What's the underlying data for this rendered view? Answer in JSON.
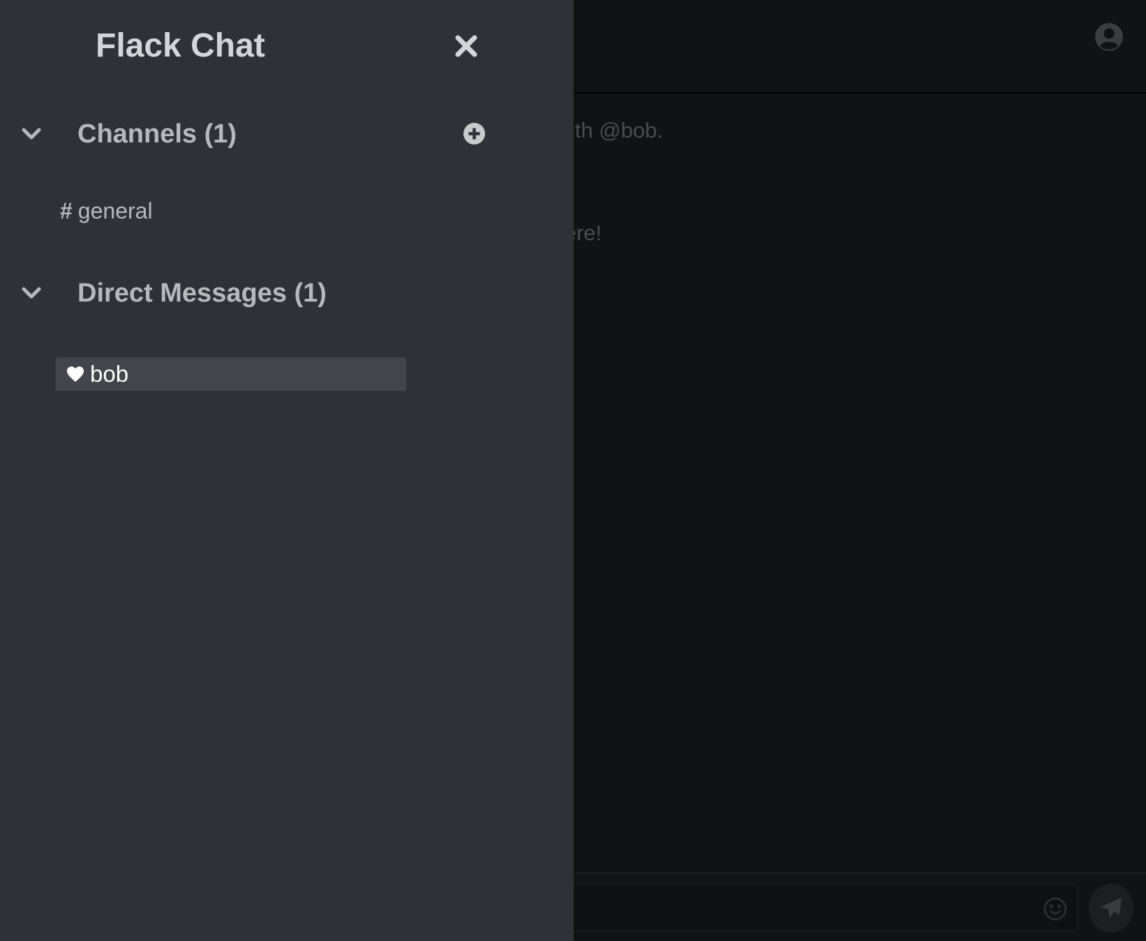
{
  "app": {
    "title": "Flack Chat"
  },
  "conversation": {
    "messages": [
      {
        "text": "th @bob."
      },
      {
        "text": "ere!"
      }
    ]
  },
  "sidebar": {
    "channels": {
      "title": "Channels (1)",
      "items": [
        {
          "label": "general",
          "prefix": "#"
        }
      ]
    },
    "direct_messages": {
      "title": "Direct Messages (1)",
      "items": [
        {
          "label": "bob",
          "icon": "heart-icon",
          "selected": true
        }
      ]
    }
  },
  "icons": {
    "close": "close-icon",
    "chevron": "chevron-down-icon",
    "add": "plus-circle-icon",
    "user": "user-circle-icon",
    "emoji": "emoji-icon",
    "send": "paper-plane-icon"
  },
  "colors": {
    "drawer_bg": "#303136",
    "main_bg": "#111214",
    "selected_item_bg": "#42464c",
    "title_text": "#d4d5d8",
    "muted_text": "#b7b8bb"
  }
}
